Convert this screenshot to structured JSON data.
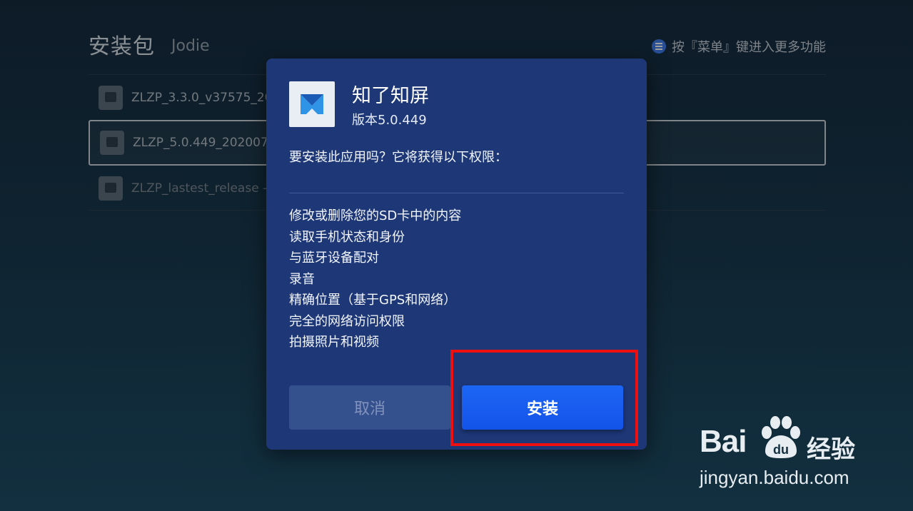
{
  "background": {
    "title": "安装包",
    "subtitle": "Jodie",
    "hint": "按『菜单』键进入更多功能",
    "files": [
      {
        "name": "ZLZP_3.3.0_v37575_20"
      },
      {
        "name": "ZLZP_5.0.449_2020072"
      },
      {
        "name": "ZLZP_lastest_release -"
      }
    ]
  },
  "dialog": {
    "app_name": "知了知屏",
    "version": "版本5.0.449",
    "question": "要安装此应用吗？它将获得以下权限：",
    "permissions": [
      "修改或删除您的SD卡中的内容",
      "读取手机状态和身份",
      "与蓝牙设备配对",
      "录音",
      "精确位置（基于GPS和网络）",
      "完全的网络访问权限",
      "拍摄照片和视频"
    ],
    "cancel_label": "取消",
    "install_label": "安装"
  },
  "watermark": {
    "brand_left": "Bai",
    "brand_right": "经验",
    "url": "jingyan.baidu.com"
  },
  "colors": {
    "dialog_bg": "#1d3777",
    "install_button": "#1c66f5",
    "highlight": "#ee1010"
  }
}
